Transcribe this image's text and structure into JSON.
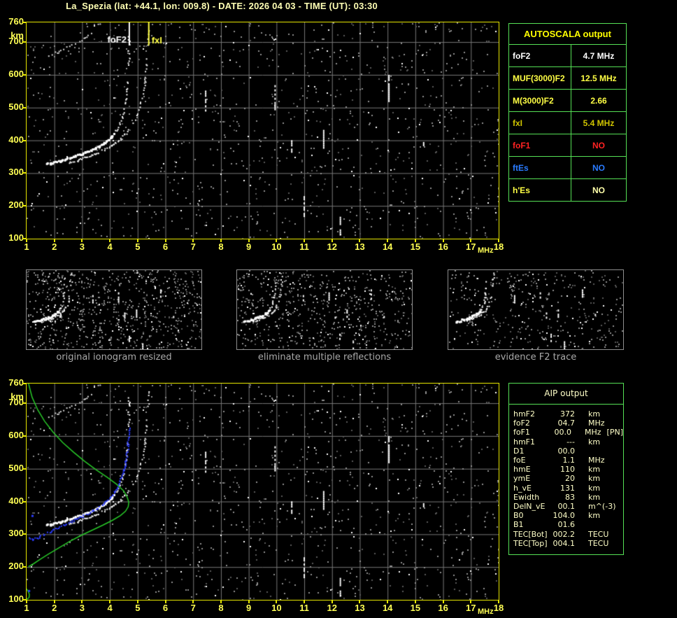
{
  "header": {
    "title": "La_Spezia (lat: +44.1, lon: 009.8) - DATE: 2026 04 03 - TIME (UT): 03:30"
  },
  "colors": {
    "axis_yellow": "#ffff55",
    "title_yellow": "#ffffb4",
    "border_yellow": "#e6e600",
    "table_green": "#55e055",
    "grid_gray": "#787878",
    "trace_white": "#ffffff",
    "profile_green": "#28c828",
    "restored_blue": "#2b3cff",
    "caption_gray": "#a9a9a9"
  },
  "top_plot": {
    "y_unit": "km",
    "x_unit": "MHz",
    "y_ticks": [
      760,
      700,
      600,
      500,
      400,
      300,
      200,
      100
    ],
    "x_ticks": [
      1,
      2,
      3,
      4,
      5,
      6,
      7,
      8,
      9,
      10,
      11,
      12,
      13,
      14,
      15,
      16,
      17,
      18
    ]
  },
  "bottom_plot": {
    "y_unit": "km",
    "x_unit": "MHz",
    "y_ticks": [
      760,
      700,
      600,
      500,
      400,
      300,
      200,
      100
    ],
    "x_ticks": [
      1,
      2,
      3,
      4,
      5,
      6,
      7,
      8,
      9,
      10,
      11,
      12,
      13,
      14,
      15,
      16,
      17,
      18
    ]
  },
  "autoscala_table": {
    "title": "AUTOSCALA output",
    "rows": [
      {
        "label": "foF2",
        "value": "4.7 MHz",
        "label_color": "#ffffff",
        "value_color": "#ffffff"
      },
      {
        "label": "MUF(3000)F2",
        "value": "12.5 MHz",
        "label_color": "#ffff44",
        "value_color": "#ffff44"
      },
      {
        "label": "M(3000)F2",
        "value": "2.66",
        "label_color": "#ffff44",
        "value_color": "#ffff44"
      },
      {
        "label": "fxI",
        "value": "5.4 MHz",
        "label_color": "#cfc400",
        "value_color": "#cfc400"
      },
      {
        "label": "foF1",
        "value": "NO",
        "label_color": "#ff2222",
        "value_color": "#ff2222"
      },
      {
        "label": "ftEs",
        "value": "NO",
        "label_color": "#2a7bff",
        "value_color": "#2a7bff"
      },
      {
        "label": "h'Es",
        "value": "NO",
        "label_color": "#ffff44",
        "value_color": "#ffffaa"
      }
    ]
  },
  "thumbnails": [
    {
      "caption": "original ionogram resized"
    },
    {
      "caption": "eliminate multiple reflections"
    },
    {
      "caption": "evidence F2 trace"
    }
  ],
  "aip_table": {
    "title": "AIP output",
    "rows": [
      [
        "hmF2",
        "372",
        "km",
        ""
      ],
      [
        "foF2",
        "04.7",
        "MHz",
        ""
      ],
      [
        "foF1",
        "00.0",
        "MHz",
        "[PN]"
      ],
      [
        "hmF1",
        "---",
        "km",
        ""
      ],
      [
        "D1",
        "00.0",
        "",
        ""
      ],
      [
        "foE",
        "1.1",
        "MHz",
        ""
      ],
      [
        "hmE",
        "110",
        "km",
        ""
      ],
      [
        "ymE",
        "20",
        "km",
        ""
      ],
      [
        "h_vE",
        "131",
        "km",
        ""
      ],
      [
        "Ewidth",
        "83",
        "km",
        ""
      ],
      [
        "DelN_vE",
        "00.1",
        "m^(-3)",
        ""
      ],
      [
        "B0",
        "104.0",
        "km",
        ""
      ],
      [
        "B1",
        "01.6",
        "",
        ""
      ],
      [
        "TEC[Bot]",
        "002.2",
        "TECU",
        ""
      ],
      [
        "TEC[Top]",
        "004.1",
        "TECU",
        ""
      ]
    ]
  },
  "chart_data": {
    "type": "scatter",
    "description": "Vertical incidence ionogram: virtual height (km) vs sounding frequency (MHz); same echo field shown in top and bottom panels and in the three thumbnails",
    "x_axis": {
      "label": "MHz",
      "min": 1,
      "max": 18,
      "grid": true
    },
    "y_axis": {
      "label": "km",
      "min": 100,
      "max": 760,
      "grid": true
    },
    "foF2_marker": {
      "freq_mhz": 4.7,
      "label": "foF2",
      "color": "#ffffff"
    },
    "fxI_marker": {
      "freq_mhz": 5.4,
      "label": "fxI",
      "color": "#ffff44"
    },
    "o_trace": [
      [
        1.75,
        327
      ],
      [
        1.95,
        330
      ],
      [
        2.2,
        336
      ],
      [
        2.5,
        344
      ],
      [
        2.8,
        352
      ],
      [
        3.1,
        361
      ],
      [
        3.4,
        371
      ],
      [
        3.7,
        385
      ],
      [
        3.95,
        400
      ],
      [
        4.15,
        418
      ],
      [
        4.3,
        438
      ],
      [
        4.42,
        462
      ],
      [
        4.52,
        490
      ],
      [
        4.6,
        525
      ],
      [
        4.64,
        558
      ],
      [
        4.67,
        595
      ],
      [
        4.69,
        635
      ],
      [
        4.7,
        680
      ],
      [
        4.7,
        725
      ]
    ],
    "x_trace": [
      [
        2.55,
        331
      ],
      [
        2.9,
        341
      ],
      [
        3.3,
        352
      ],
      [
        3.7,
        366
      ],
      [
        4.05,
        382
      ],
      [
        4.35,
        400
      ],
      [
        4.6,
        421
      ],
      [
        4.8,
        443
      ],
      [
        4.95,
        468
      ],
      [
        5.08,
        499
      ],
      [
        5.18,
        533
      ],
      [
        5.26,
        570
      ],
      [
        5.32,
        612
      ],
      [
        5.36,
        655
      ],
      [
        5.39,
        700
      ],
      [
        5.4,
        750
      ]
    ],
    "multiple_reflection_trace": [
      [
        1.75,
        655
      ],
      [
        2.2,
        672
      ],
      [
        2.6,
        688
      ],
      [
        3.0,
        706
      ],
      [
        3.3,
        725
      ],
      [
        3.55,
        750
      ],
      [
        3.65,
        760
      ]
    ],
    "rfi_streaks": [
      {
        "f": 7.45,
        "a": 490,
        "b": 552
      },
      {
        "f": 9.95,
        "a": 498,
        "b": 575
      },
      {
        "f": 10.55,
        "a": 363,
        "b": 407
      },
      {
        "f": 11.0,
        "a": 168,
        "b": 230
      },
      {
        "f": 11.7,
        "a": 370,
        "b": 432
      },
      {
        "f": 12.3,
        "a": 113,
        "b": 167
      },
      {
        "f": 14.05,
        "a": 523,
        "b": 600
      },
      {
        "f": 15.3,
        "a": 365,
        "b": 395
      }
    ],
    "profile_green": [
      [
        1.07,
        760
      ],
      [
        1.2,
        718
      ],
      [
        1.4,
        680
      ],
      [
        1.65,
        645
      ],
      [
        1.95,
        612
      ],
      [
        2.3,
        580
      ],
      [
        2.7,
        550
      ],
      [
        3.1,
        522
      ],
      [
        3.5,
        497
      ],
      [
        3.9,
        474
      ],
      [
        4.25,
        452
      ],
      [
        4.5,
        432
      ],
      [
        4.62,
        414
      ],
      [
        4.68,
        398
      ],
      [
        4.66,
        384
      ],
      [
        4.56,
        370
      ],
      [
        4.38,
        357
      ],
      [
        4.1,
        343
      ],
      [
        3.75,
        328
      ],
      [
        3.35,
        312
      ],
      [
        2.95,
        296
      ],
      [
        2.55,
        278
      ],
      [
        2.15,
        258
      ],
      [
        1.8,
        240
      ],
      [
        1.5,
        224
      ],
      [
        1.25,
        210
      ],
      [
        1.07,
        201
      ]
    ],
    "profile_e_layer": [
      [
        0.97,
        136
      ],
      [
        1.04,
        128
      ],
      [
        1.1,
        117
      ],
      [
        1.09,
        107
      ],
      [
        1.02,
        102
      ],
      [
        0.97,
        105
      ]
    ],
    "restored_trace_blue": [
      [
        1.1,
        287
      ],
      [
        1.22,
        283
      ],
      [
        1.4,
        289
      ],
      [
        1.65,
        299
      ],
      [
        1.95,
        311
      ],
      [
        2.25,
        323
      ],
      [
        2.55,
        335
      ],
      [
        2.85,
        347
      ],
      [
        3.15,
        359
      ],
      [
        3.45,
        373
      ],
      [
        3.72,
        388
      ],
      [
        3.95,
        405
      ],
      [
        4.15,
        424
      ],
      [
        4.3,
        446
      ],
      [
        4.42,
        471
      ],
      [
        4.52,
        499
      ],
      [
        4.6,
        530
      ],
      [
        4.65,
        561
      ],
      [
        4.68,
        594
      ],
      [
        4.7,
        627
      ]
    ],
    "blue_outlier_points": [
      [
        1.2,
        357
      ],
      [
        1.08,
        128
      ]
    ],
    "noise_dots": {
      "mid_gray": 620,
      "dark_gray": 430,
      "white": 100
    }
  }
}
